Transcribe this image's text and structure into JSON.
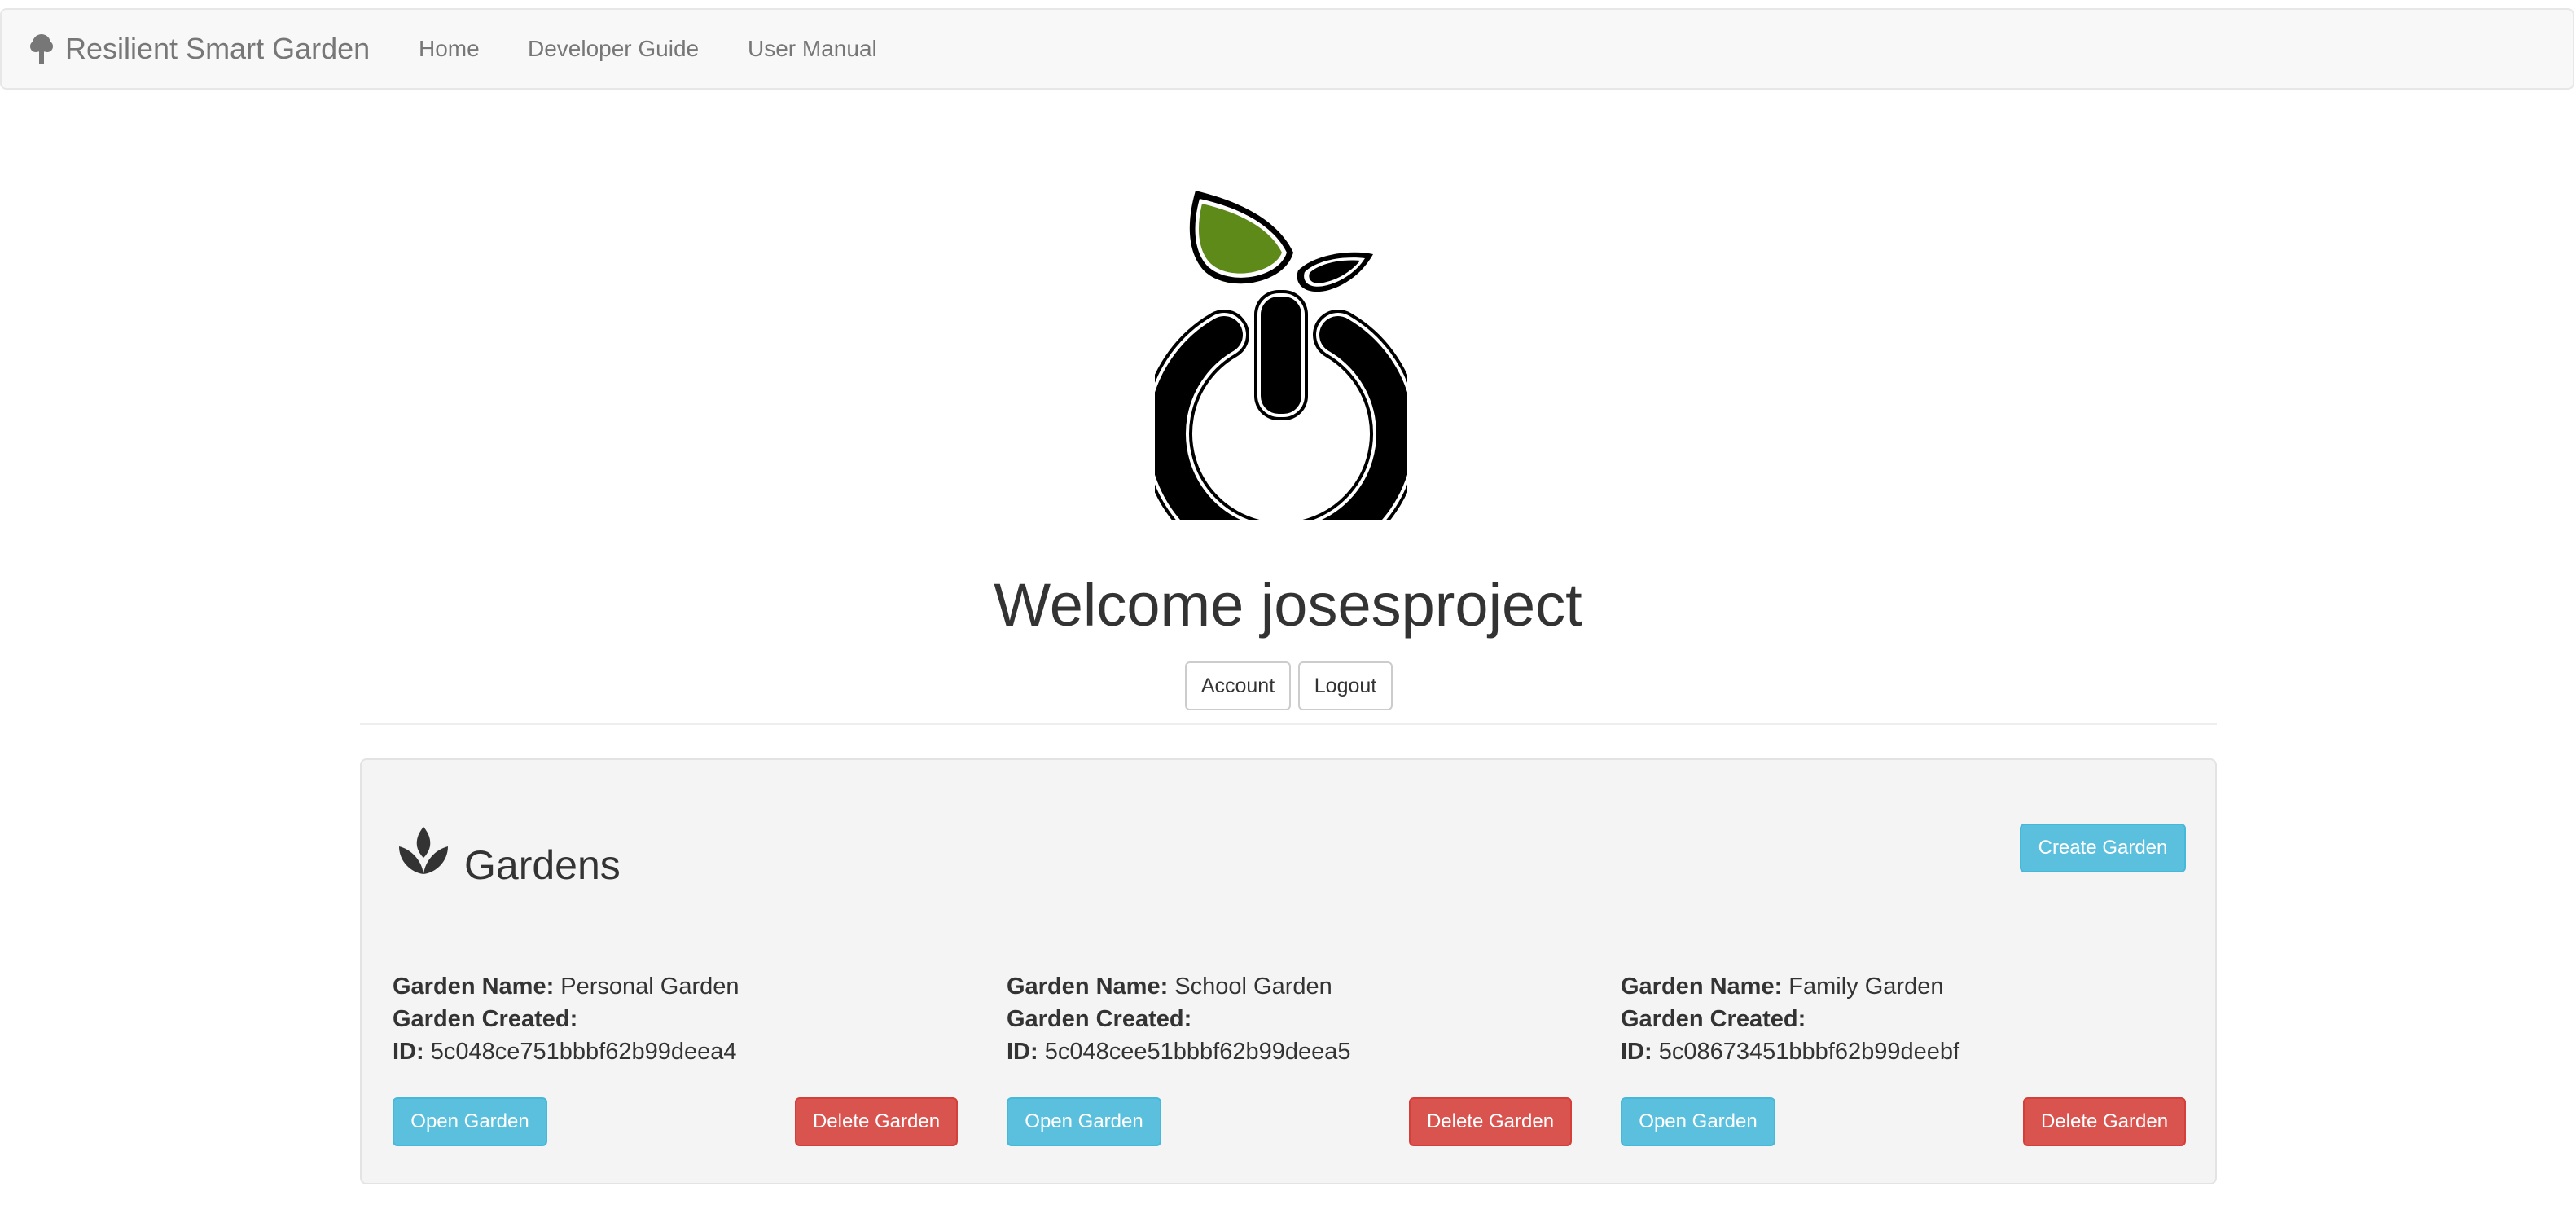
{
  "navbar": {
    "brand": "Resilient Smart Garden",
    "brand_icon": "tree-icon",
    "links": [
      "Home",
      "Developer Guide",
      "User Manual"
    ]
  },
  "hero": {
    "logo": "power-sprout-logo",
    "welcome": "Welcome josesproject",
    "account_label": "Account",
    "logout_label": "Logout"
  },
  "gardens": {
    "title": "Gardens",
    "icon": "sprout-icon",
    "create_label": "Create Garden",
    "field_labels": {
      "name": "Garden Name:",
      "created": "Garden Created:",
      "id": "ID:"
    },
    "open_label": "Open Garden",
    "delete_label": "Delete Garden",
    "items": [
      {
        "name": "Personal Garden",
        "created": "",
        "id": "5c048ce751bbbf62b99deea4"
      },
      {
        "name": "School Garden",
        "created": "",
        "id": "5c048cee51bbbf62b99deea5"
      },
      {
        "name": "Family Garden",
        "created": "",
        "id": "5c08673451bbbf62b99deebf"
      }
    ]
  },
  "colors": {
    "leaf": "#5e8a1a",
    "info": "#5bc0de",
    "danger": "#d9534f",
    "navbar_bg": "#f8f8f8"
  }
}
